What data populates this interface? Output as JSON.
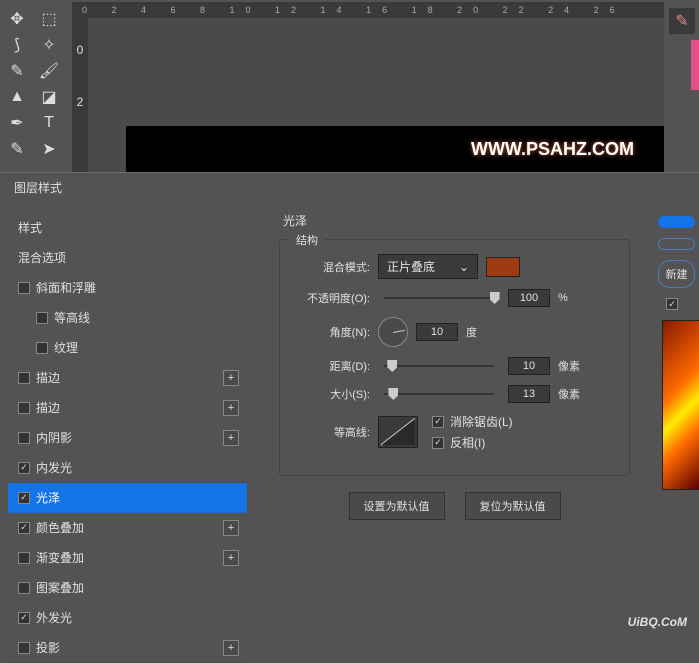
{
  "ruler_h": "0  2  4  6  8  10 12 14 16 18 20 22 24 26",
  "ruler_v": [
    "0",
    "2"
  ],
  "canvas_text": "WWW.PSAHZ.COM",
  "dialog_title": "图层样式",
  "left": {
    "header": "样式",
    "blending": "混合选项",
    "items": [
      {
        "label": "斜面和浮雕",
        "checked": false,
        "indent": false,
        "plus": false
      },
      {
        "label": "等高线",
        "checked": false,
        "indent": true,
        "plus": false
      },
      {
        "label": "纹理",
        "checked": false,
        "indent": true,
        "plus": false
      },
      {
        "label": "描边",
        "checked": false,
        "indent": false,
        "plus": true
      },
      {
        "label": "描边",
        "checked": false,
        "indent": false,
        "plus": true
      },
      {
        "label": "内阴影",
        "checked": false,
        "indent": false,
        "plus": true
      },
      {
        "label": "内发光",
        "checked": true,
        "indent": false,
        "plus": false
      },
      {
        "label": "光泽",
        "checked": true,
        "indent": false,
        "plus": false,
        "selected": true
      },
      {
        "label": "颜色叠加",
        "checked": true,
        "indent": false,
        "plus": true
      },
      {
        "label": "渐变叠加",
        "checked": false,
        "indent": false,
        "plus": true
      },
      {
        "label": "图案叠加",
        "checked": false,
        "indent": false,
        "plus": false
      },
      {
        "label": "外发光",
        "checked": true,
        "indent": false,
        "plus": false
      },
      {
        "label": "投影",
        "checked": false,
        "indent": false,
        "plus": true
      }
    ]
  },
  "mid": {
    "title": "光泽",
    "group": "结构",
    "blend_mode_label": "混合模式:",
    "blend_mode_value": "正片叠底",
    "opacity_label": "不透明度(O):",
    "opacity_value": "100",
    "opacity_unit": "%",
    "angle_label": "角度(N):",
    "angle_value": "10",
    "angle_unit": "度",
    "distance_label": "距离(D):",
    "distance_value": "10",
    "distance_unit": "像素",
    "size_label": "大小(S):",
    "size_value": "13",
    "size_unit": "像素",
    "contour_label": "等高线:",
    "antialias": "消除锯齿(L)",
    "invert": "反相(I)",
    "btn_default": "设置为默认值",
    "btn_reset": "复位为默认值",
    "color": "#9c3b0f"
  },
  "right": {
    "new_btn": "新建",
    "preview_cb": ""
  },
  "watermark": "UiBQ.CoM"
}
